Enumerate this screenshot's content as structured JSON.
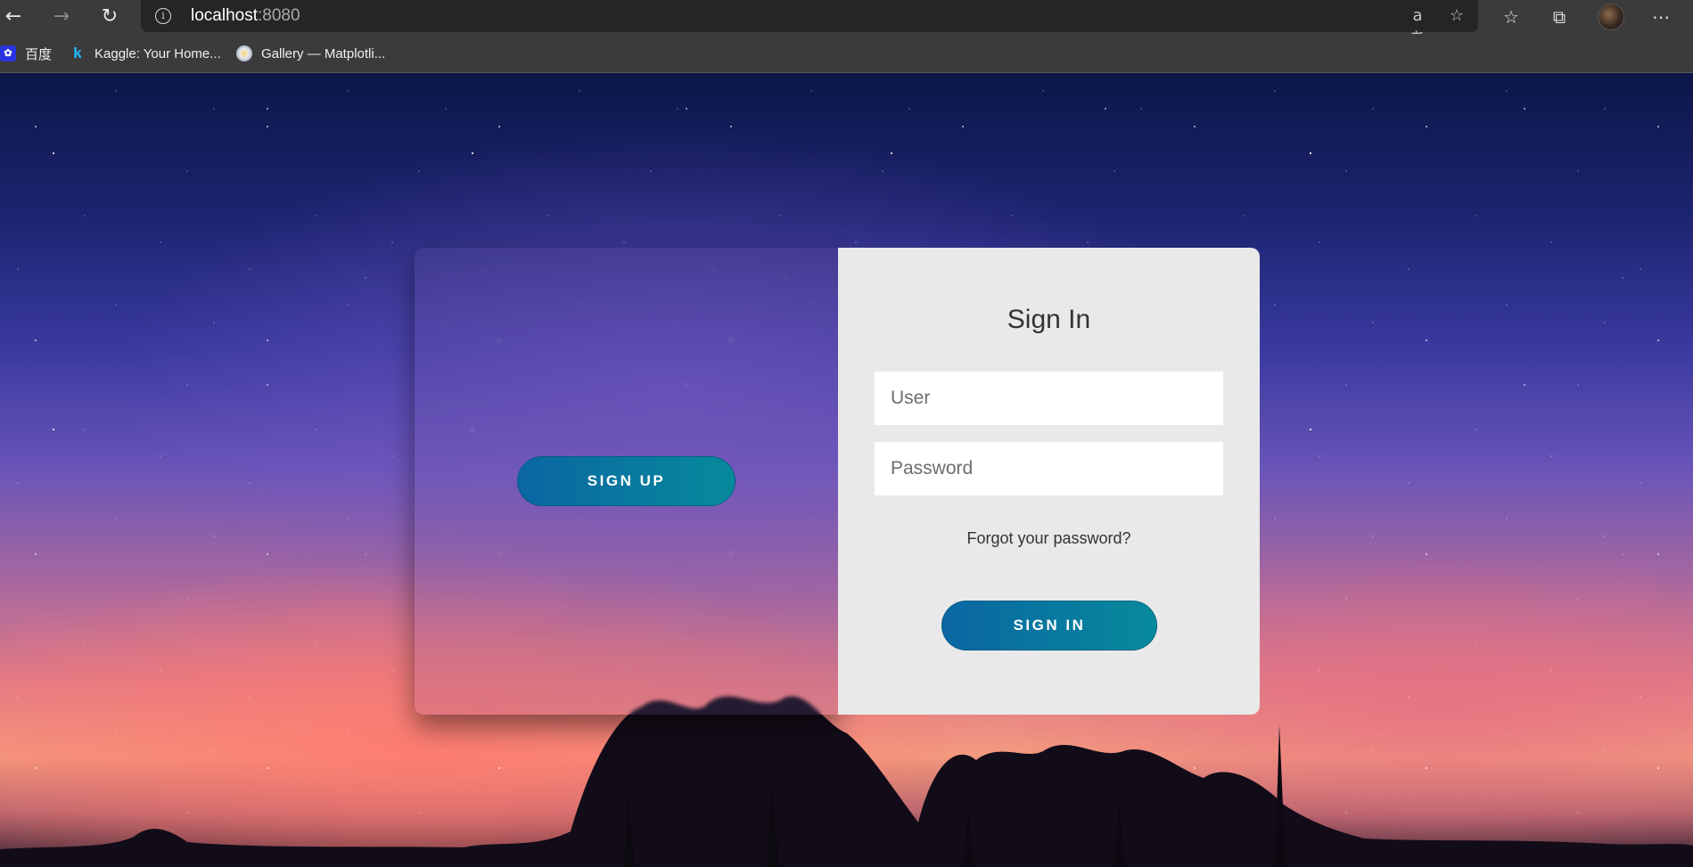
{
  "browser": {
    "url_host": "localhost",
    "url_port": ":8080",
    "bookmarks": [
      {
        "label": "百度",
        "icon": "baidu-icon"
      },
      {
        "label": "Kaggle: Your Home...",
        "icon": "kaggle-icon"
      },
      {
        "label": "Gallery — Matplotli...",
        "icon": "matplotlib-icon"
      }
    ],
    "toolbar_icons": [
      "back-icon",
      "forward-icon",
      "refresh-icon",
      "info-icon",
      "read-aloud-icon",
      "add-favorite-icon",
      "favorites-icon",
      "collections-icon",
      "profile-avatar",
      "more-icon"
    ]
  },
  "login": {
    "signup_label": "SIGN UP",
    "title": "Sign In",
    "user_placeholder": "User",
    "password_placeholder": "Password",
    "forgot_label": "Forgot your password?",
    "signin_label": "SIGN IN"
  },
  "colors": {
    "button_gradient_start": "#0a66a2",
    "button_gradient_end": "#078a9c",
    "card_background": "#e9e9e9",
    "chrome_background": "#3b3b3b"
  }
}
